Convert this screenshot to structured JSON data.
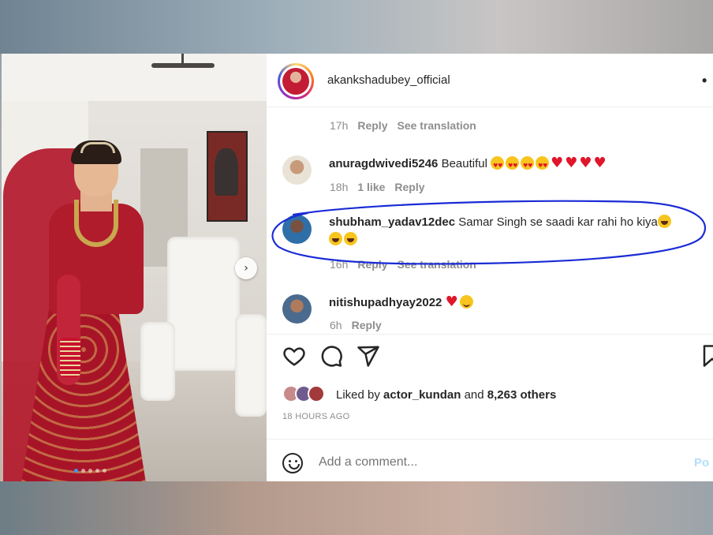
{
  "post": {
    "username": "akankshadubey_official",
    "more_icon": "•",
    "carousel_next": "›"
  },
  "comments": [
    {
      "user": "",
      "text": "",
      "time": "17h",
      "reply": "Reply",
      "translate": "See translation"
    },
    {
      "user": "anuragdwivedi5246",
      "text": "Beautiful",
      "time": "18h",
      "likes": "1 like",
      "reply": "Reply"
    },
    {
      "user": "shubham_yadav12dec",
      "text": "Samar Singh se saadi kar rahi ho kiya",
      "time": "16h",
      "reply": "Reply",
      "translate": "See translation"
    },
    {
      "user": "nitishupadhyay2022",
      "text": "",
      "time": "6h",
      "reply": "Reply"
    }
  ],
  "likes": {
    "prefix": "Liked by",
    "user": "actor_kundan",
    "conj": "and",
    "others": "8,263 others"
  },
  "timestamp": "18 HOURS AGO",
  "add_comment": {
    "placeholder": "Add a comment...",
    "post_label": "Po"
  },
  "colors": {
    "annotation": "#1a2bd6",
    "heart": "#e0162b",
    "meta": "#8e8e8e"
  },
  "icons": [
    "heart-icon",
    "comment-icon",
    "share-icon",
    "bookmark-icon",
    "emoji-icon",
    "chevron-right-icon"
  ]
}
